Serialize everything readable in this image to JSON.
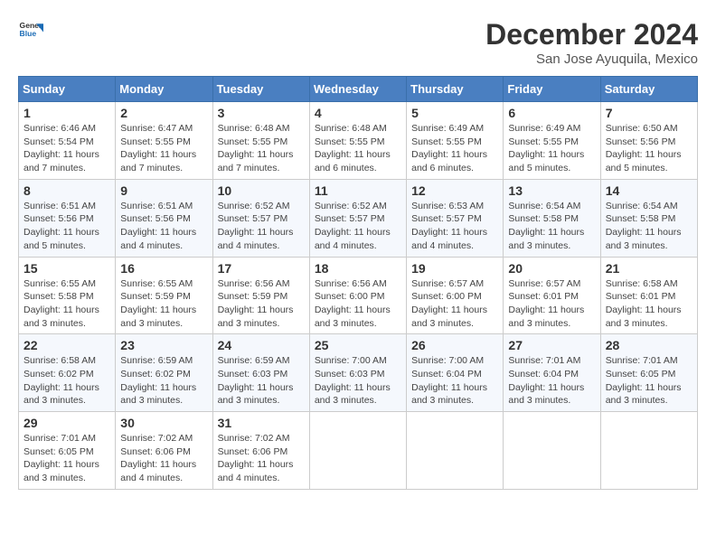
{
  "header": {
    "logo_general": "General",
    "logo_blue": "Blue",
    "month_title": "December 2024",
    "location": "San Jose Ayuquila, Mexico"
  },
  "days_of_week": [
    "Sunday",
    "Monday",
    "Tuesday",
    "Wednesday",
    "Thursday",
    "Friday",
    "Saturday"
  ],
  "weeks": [
    [
      {
        "day": "1",
        "info": "Sunrise: 6:46 AM\nSunset: 5:54 PM\nDaylight: 11 hours and 7 minutes."
      },
      {
        "day": "2",
        "info": "Sunrise: 6:47 AM\nSunset: 5:55 PM\nDaylight: 11 hours and 7 minutes."
      },
      {
        "day": "3",
        "info": "Sunrise: 6:48 AM\nSunset: 5:55 PM\nDaylight: 11 hours and 7 minutes."
      },
      {
        "day": "4",
        "info": "Sunrise: 6:48 AM\nSunset: 5:55 PM\nDaylight: 11 hours and 6 minutes."
      },
      {
        "day": "5",
        "info": "Sunrise: 6:49 AM\nSunset: 5:55 PM\nDaylight: 11 hours and 6 minutes."
      },
      {
        "day": "6",
        "info": "Sunrise: 6:49 AM\nSunset: 5:55 PM\nDaylight: 11 hours and 5 minutes."
      },
      {
        "day": "7",
        "info": "Sunrise: 6:50 AM\nSunset: 5:56 PM\nDaylight: 11 hours and 5 minutes."
      }
    ],
    [
      {
        "day": "8",
        "info": "Sunrise: 6:51 AM\nSunset: 5:56 PM\nDaylight: 11 hours and 5 minutes."
      },
      {
        "day": "9",
        "info": "Sunrise: 6:51 AM\nSunset: 5:56 PM\nDaylight: 11 hours and 4 minutes."
      },
      {
        "day": "10",
        "info": "Sunrise: 6:52 AM\nSunset: 5:57 PM\nDaylight: 11 hours and 4 minutes."
      },
      {
        "day": "11",
        "info": "Sunrise: 6:52 AM\nSunset: 5:57 PM\nDaylight: 11 hours and 4 minutes."
      },
      {
        "day": "12",
        "info": "Sunrise: 6:53 AM\nSunset: 5:57 PM\nDaylight: 11 hours and 4 minutes."
      },
      {
        "day": "13",
        "info": "Sunrise: 6:54 AM\nSunset: 5:58 PM\nDaylight: 11 hours and 3 minutes."
      },
      {
        "day": "14",
        "info": "Sunrise: 6:54 AM\nSunset: 5:58 PM\nDaylight: 11 hours and 3 minutes."
      }
    ],
    [
      {
        "day": "15",
        "info": "Sunrise: 6:55 AM\nSunset: 5:58 PM\nDaylight: 11 hours and 3 minutes."
      },
      {
        "day": "16",
        "info": "Sunrise: 6:55 AM\nSunset: 5:59 PM\nDaylight: 11 hours and 3 minutes."
      },
      {
        "day": "17",
        "info": "Sunrise: 6:56 AM\nSunset: 5:59 PM\nDaylight: 11 hours and 3 minutes."
      },
      {
        "day": "18",
        "info": "Sunrise: 6:56 AM\nSunset: 6:00 PM\nDaylight: 11 hours and 3 minutes."
      },
      {
        "day": "19",
        "info": "Sunrise: 6:57 AM\nSunset: 6:00 PM\nDaylight: 11 hours and 3 minutes."
      },
      {
        "day": "20",
        "info": "Sunrise: 6:57 AM\nSunset: 6:01 PM\nDaylight: 11 hours and 3 minutes."
      },
      {
        "day": "21",
        "info": "Sunrise: 6:58 AM\nSunset: 6:01 PM\nDaylight: 11 hours and 3 minutes."
      }
    ],
    [
      {
        "day": "22",
        "info": "Sunrise: 6:58 AM\nSunset: 6:02 PM\nDaylight: 11 hours and 3 minutes."
      },
      {
        "day": "23",
        "info": "Sunrise: 6:59 AM\nSunset: 6:02 PM\nDaylight: 11 hours and 3 minutes."
      },
      {
        "day": "24",
        "info": "Sunrise: 6:59 AM\nSunset: 6:03 PM\nDaylight: 11 hours and 3 minutes."
      },
      {
        "day": "25",
        "info": "Sunrise: 7:00 AM\nSunset: 6:03 PM\nDaylight: 11 hours and 3 minutes."
      },
      {
        "day": "26",
        "info": "Sunrise: 7:00 AM\nSunset: 6:04 PM\nDaylight: 11 hours and 3 minutes."
      },
      {
        "day": "27",
        "info": "Sunrise: 7:01 AM\nSunset: 6:04 PM\nDaylight: 11 hours and 3 minutes."
      },
      {
        "day": "28",
        "info": "Sunrise: 7:01 AM\nSunset: 6:05 PM\nDaylight: 11 hours and 3 minutes."
      }
    ],
    [
      {
        "day": "29",
        "info": "Sunrise: 7:01 AM\nSunset: 6:05 PM\nDaylight: 11 hours and 3 minutes."
      },
      {
        "day": "30",
        "info": "Sunrise: 7:02 AM\nSunset: 6:06 PM\nDaylight: 11 hours and 4 minutes."
      },
      {
        "day": "31",
        "info": "Sunrise: 7:02 AM\nSunset: 6:06 PM\nDaylight: 11 hours and 4 minutes."
      },
      {
        "day": "",
        "info": ""
      },
      {
        "day": "",
        "info": ""
      },
      {
        "day": "",
        "info": ""
      },
      {
        "day": "",
        "info": ""
      }
    ]
  ]
}
